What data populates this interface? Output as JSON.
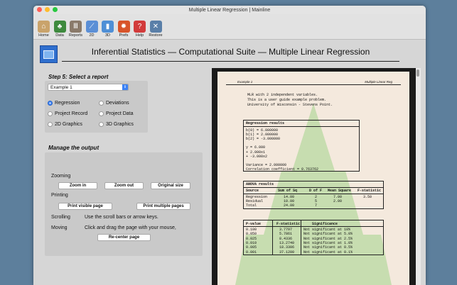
{
  "window": {
    "title": "Multiple Linear Regression | Mainline",
    "light_colors": [
      "#fe5f57",
      "#febc2e",
      "#28c840"
    ]
  },
  "toolbar": {
    "items": [
      {
        "label": "Home",
        "icon": "house-icon",
        "color": "#c9a36b",
        "glyph": "⌂"
      },
      {
        "label": "Data",
        "icon": "tree-icon",
        "color": "#3e8a3e",
        "glyph": "♣"
      },
      {
        "label": "Reports",
        "icon": "columns-icon",
        "color": "#8a7a6a",
        "glyph": "Ⅲ"
      },
      {
        "label": "2D",
        "icon": "line-chart-icon",
        "color": "#5b8fd6",
        "glyph": "⟋"
      },
      {
        "label": "3D",
        "icon": "bar-chart-icon",
        "color": "#4f8fd6",
        "glyph": "▮"
      },
      {
        "label": "Prefs",
        "icon": "maple-leaf-icon",
        "color": "#d8542a",
        "glyph": "✹"
      },
      {
        "label": "Help",
        "icon": "help-icon",
        "color": "#d23b3b",
        "glyph": "?"
      },
      {
        "label": "Restore",
        "icon": "tools-icon",
        "color": "#5a7fa8",
        "glyph": "✕"
      }
    ]
  },
  "main": {
    "heading": "Inferential Statistics — Computational Suite — Multiple Linear Regression",
    "step_title": "Step 5: Select a report",
    "report_select": "Example 1",
    "report_options": [
      {
        "label": "Regression",
        "selected": true
      },
      {
        "label": "Deviations",
        "selected": false
      },
      {
        "label": "Project Record",
        "selected": false
      },
      {
        "label": "Project Data",
        "selected": false
      },
      {
        "label": "2D Graphics",
        "selected": false
      },
      {
        "label": "3D Graphics",
        "selected": false
      }
    ],
    "manage_title": "Manage the output",
    "zooming_label": "Zooming",
    "zoom_in": "Zoom in",
    "zoom_out": "Zoom out",
    "original_size": "Original size",
    "printing_label": "Printing",
    "print_visible": "Print visible page",
    "print_multiple": "Print multiple pages",
    "scrolling_label": "Scrolling",
    "scrolling_text": "Use the scroll bars or arrow keys.",
    "moving_label": "Moving",
    "moving_text": "Click and drag the page with your mouse,",
    "recenter": "Re-center page"
  },
  "report": {
    "head_left": "Example 1",
    "head_right": "Multiple Linear Reg",
    "intro": [
      "MLR with 2 independent variables.",
      "This is a user guide example problem.",
      "University of Wisconsin - Stevens Point."
    ],
    "regression_title": "Regression results",
    "regression_lines": [
      "b(0) = 6.000000",
      "b(1) = 2.000000",
      "b(2) = -3.000000",
      "",
      "y = 6.000",
      "+ 2.000x1",
      "+ -3.000x2",
      "",
      "Variance = 2.000000",
      "Correlation coefficient = 0.763762"
    ],
    "anova_title": "ANOVA results",
    "anova_headers": [
      "Source",
      "Sum of Sq",
      "D of F",
      "Mean Square",
      "F-statistic"
    ],
    "anova_rows": [
      [
        "Regression",
        "14.00",
        "2",
        "7.00",
        "3.50"
      ],
      [
        "Residual",
        "10.00",
        "5",
        "2.00",
        ""
      ],
      [
        "Total",
        "24.00",
        "7",
        "",
        ""
      ]
    ],
    "p_headers": [
      "P-value",
      "F-statistic",
      "Significance"
    ],
    "p_rows": [
      [
        "0.100",
        "3.7797",
        "Not significant at 10%"
      ],
      [
        "0.050",
        "5.7861",
        "Not significant at 5.0%"
      ],
      [
        "0.025",
        "8.4336",
        "Not significant at 2.5%"
      ],
      [
        "0.010",
        "13.2740",
        "Not significant at 1.0%"
      ],
      [
        "0.005",
        "18.3306",
        "Not significant at 0.5%"
      ],
      [
        "0.001",
        "37.1200",
        "Not significant at 0.1%"
      ]
    ]
  }
}
